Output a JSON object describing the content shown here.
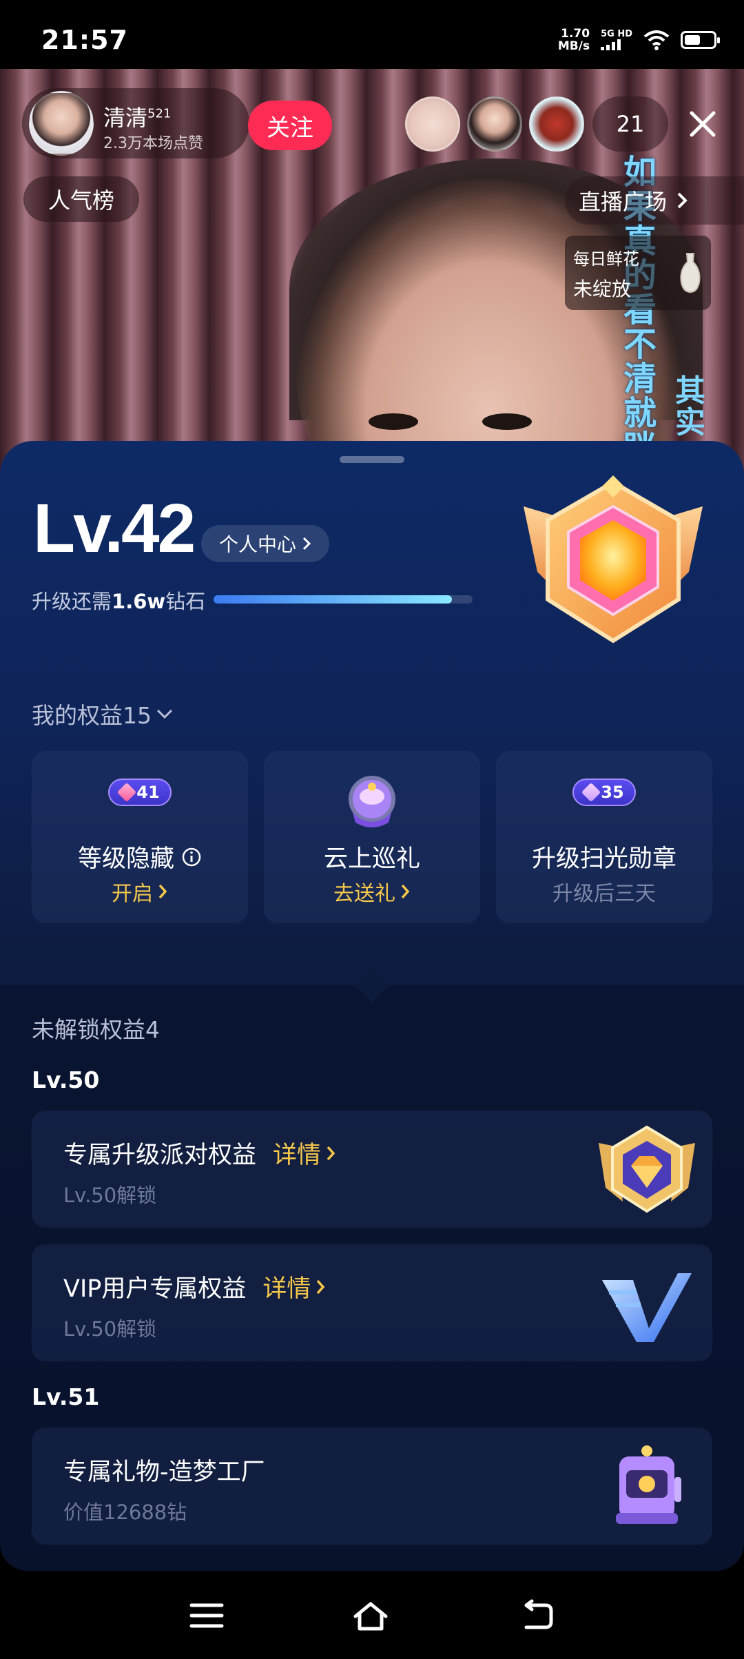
{
  "status_bar": {
    "time": "21:57",
    "speed_value": "1.70",
    "speed_unit": "MB/s",
    "network": "5G HD"
  },
  "live": {
    "host_name": "清清",
    "host_sup": "521",
    "host_likes": "2.3万本场点赞",
    "follow_label": "关注",
    "viewer_count": "21",
    "rank_label": "人气榜",
    "plaza_label": "直播广场",
    "flower_line1": "每日鲜花",
    "flower_line2": "未绽放",
    "overlay_text_1": "如果真的看不清就眯起",
    "overlay_text_2": "其实"
  },
  "level_sheet": {
    "level": "Lv.42",
    "center_label": "个人中心",
    "upgrade_prefix": "升级还需",
    "upgrade_amount": "1.6w",
    "upgrade_suffix": "钻石",
    "progress": 0.92,
    "benefits_title": "我的权益15",
    "benefits": [
      {
        "badge_num": "41",
        "name": "等级隐藏",
        "action": "开启"
      },
      {
        "name": "云上巡礼",
        "action": "去送礼"
      },
      {
        "badge_num": "35",
        "name": "升级扫光勋章",
        "action": "升级后三天"
      }
    ],
    "locked_title": "未解锁权益4",
    "groups": [
      {
        "level": "Lv.50"
      },
      {
        "level": "Lv.51"
      }
    ],
    "locked_items": [
      {
        "name": "专属升级派对权益",
        "detail": "详情",
        "sub": "Lv.50解锁"
      },
      {
        "name": "VIP用户专属权益",
        "detail": "详情",
        "sub": "Lv.50解锁"
      },
      {
        "name": "专属礼物-造梦工厂",
        "sub": "价值12688钻"
      }
    ]
  },
  "colors": {
    "follow": "#fe2c55",
    "accent_gold": "#f6c84a",
    "sheet_top": "#0e2a66"
  }
}
